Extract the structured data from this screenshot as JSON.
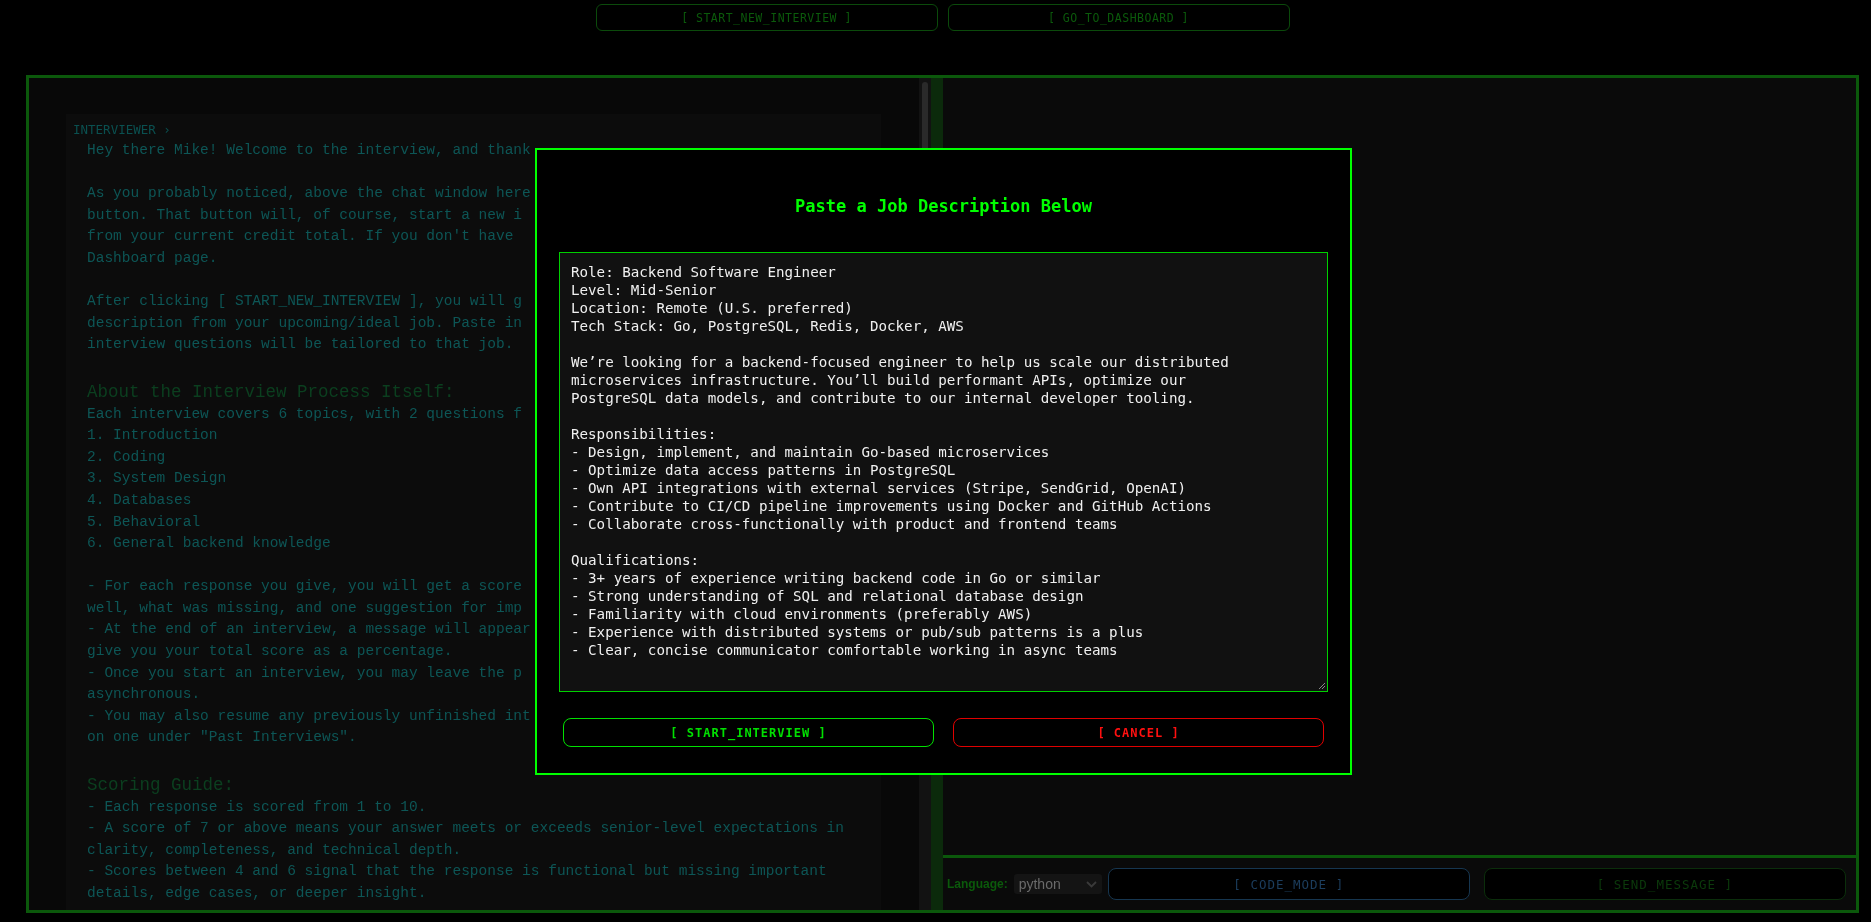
{
  "top_buttons": [
    "[ START_NEW_INTERVIEW ]",
    "[ GO_TO_DASHBOARD ]"
  ],
  "chat": {
    "messages": [
      {
        "sender": "INTERVIEWER ›",
        "blocks": [
          {
            "kind": "text",
            "text": "Hey there Mike! Welcome to the interview, and thank"
          },
          {
            "kind": "gap"
          },
          {
            "kind": "text",
            "text": "As you probably noticed, above the chat window here"
          },
          {
            "kind": "text",
            "text": "button. That button will, of course, start a new i"
          },
          {
            "kind": "text",
            "text": "from your current credit total. If you don't have"
          },
          {
            "kind": "text",
            "text": "Dashboard page."
          },
          {
            "kind": "gap"
          },
          {
            "kind": "text",
            "text": "After clicking [ START_NEW_INTERVIEW ], you will g"
          },
          {
            "kind": "text",
            "text": "description from your upcoming/ideal job. Paste in"
          },
          {
            "kind": "text",
            "text": "interview questions will be tailored to that job."
          },
          {
            "kind": "gap"
          },
          {
            "kind": "heading",
            "text": "About the Interview Process Itself:"
          },
          {
            "kind": "text",
            "text": "Each interview covers 6 topics, with 2 questions f"
          },
          {
            "kind": "text",
            "text": "1. Introduction"
          },
          {
            "kind": "text",
            "text": "2. Coding"
          },
          {
            "kind": "text",
            "text": "3. System Design"
          },
          {
            "kind": "text",
            "text": "4. Databases"
          },
          {
            "kind": "text",
            "text": "5. Behavioral"
          },
          {
            "kind": "text",
            "text": "6. General backend knowledge"
          },
          {
            "kind": "gap"
          },
          {
            "kind": "text",
            "text": "- For each response you give, you will get a score"
          },
          {
            "kind": "text",
            "text": "well, what was missing, and one suggestion for imp"
          },
          {
            "kind": "text",
            "text": "- At the end of an interview, a message will appear"
          },
          {
            "kind": "text",
            "text": "give you your total score as a percentage."
          },
          {
            "kind": "text",
            "text": "- Once you start an interview, you may leave the p"
          },
          {
            "kind": "text",
            "text": "asynchronous."
          },
          {
            "kind": "text",
            "text": "- You may also resume any previously unfinished int"
          },
          {
            "kind": "text",
            "text": "on one under \"Past Interviews\"."
          },
          {
            "kind": "gap"
          },
          {
            "kind": "heading",
            "text": "Scoring Guide:"
          },
          {
            "kind": "text",
            "text": "- Each response is scored from 1 to 10."
          },
          {
            "kind": "text",
            "text": "- A score of 7 or above means your answer meets or exceeds senior-level expectations in"
          },
          {
            "kind": "text",
            "text": "clarity, completeness, and technical depth."
          },
          {
            "kind": "text",
            "text": "- Scores between 4 and 6 signal that the response is functional but missing important"
          },
          {
            "kind": "text",
            "text": "details, edge cases, or deeper insight."
          }
        ]
      }
    ]
  },
  "input_bar": {
    "language_label": "Language:",
    "language": "python",
    "buttons": [
      "[ CODE_MODE ]",
      "[ SEND_MESSAGE ]"
    ]
  },
  "modal": {
    "title": "Paste a Job Description Below",
    "job_description": [
      [
        "Role: Backend Software Engineer",
        "Level: Mid-Senior",
        "Location: Remote (U.S. preferred)",
        "Tech Stack: Go, PostgreSQL, Redis, Docker, AWS"
      ],
      [
        "We’re looking for a backend-focused engineer to help us scale our distributed",
        "microservices infrastructure. You’ll build performant APIs, optimize our",
        "PostgreSQL data models, and contribute to our internal developer tooling."
      ],
      [
        "Responsibilities:",
        "- Design, implement, and maintain Go-based microservices",
        "- Optimize data access patterns in PostgreSQL",
        "- Own API integrations with external services (Stripe, SendGrid, OpenAI)",
        "- Contribute to CI/CD pipeline improvements using Docker and GitHub Actions",
        "- Collaborate cross-functionally with product and frontend teams"
      ],
      [
        "Qualifications:",
        "- 3+ years of experience writing backend code in Go or similar",
        "- Strong understanding of SQL and relational database design",
        "- Familiarity with cloud environments (preferably AWS)",
        "- Experience with distributed systems or pub/sub patterns is a plus",
        "- Clear, concise communicator comfortable working in async teams"
      ]
    ],
    "buttons": [
      {
        "kind": "confirm",
        "label": "[ START_INTERVIEW ]"
      },
      {
        "kind": "cancel",
        "label": "[ CANCEL ]"
      }
    ]
  }
}
